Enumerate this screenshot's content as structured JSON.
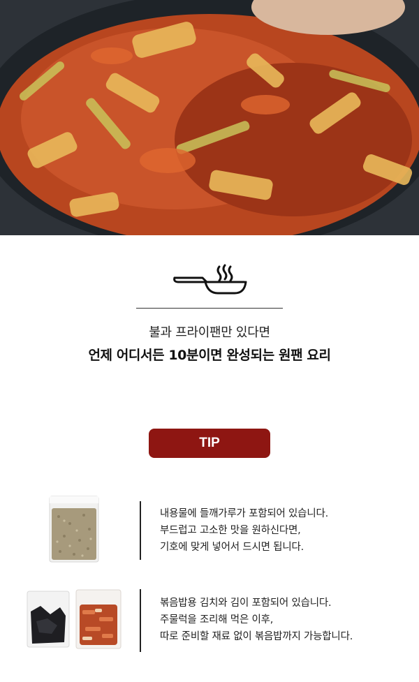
{
  "hero": {
    "image": "spicy-stir-fried-pork-with-cabbage-photo"
  },
  "intro": {
    "icon": "frying-pan-icon",
    "line1": "불과 프라이팬만 있다면",
    "line2": "언제 어디서든 10분이면 완성되는 원팬 요리"
  },
  "tip": {
    "badge": "TIP",
    "accent_color": "#8e1612",
    "items": [
      {
        "image": "perilla-seed-powder-pack",
        "lines": [
          "내용물에 들깨가루가 포함되어 있습니다.",
          "부드럽고 고소한 맛을 원하신다면,",
          "기호에 맞게 넣어서 드시면 됩니다."
        ]
      },
      {
        "image": "seaweed-and-kimchi-packs",
        "lines": [
          "볶음밥용 김치와 김이 포함되어 있습니다.",
          "주물럭을 조리해 먹은 이후,",
          "따로 준비할 재료 없이 볶음밥까지 가능합니다."
        ]
      }
    ]
  }
}
